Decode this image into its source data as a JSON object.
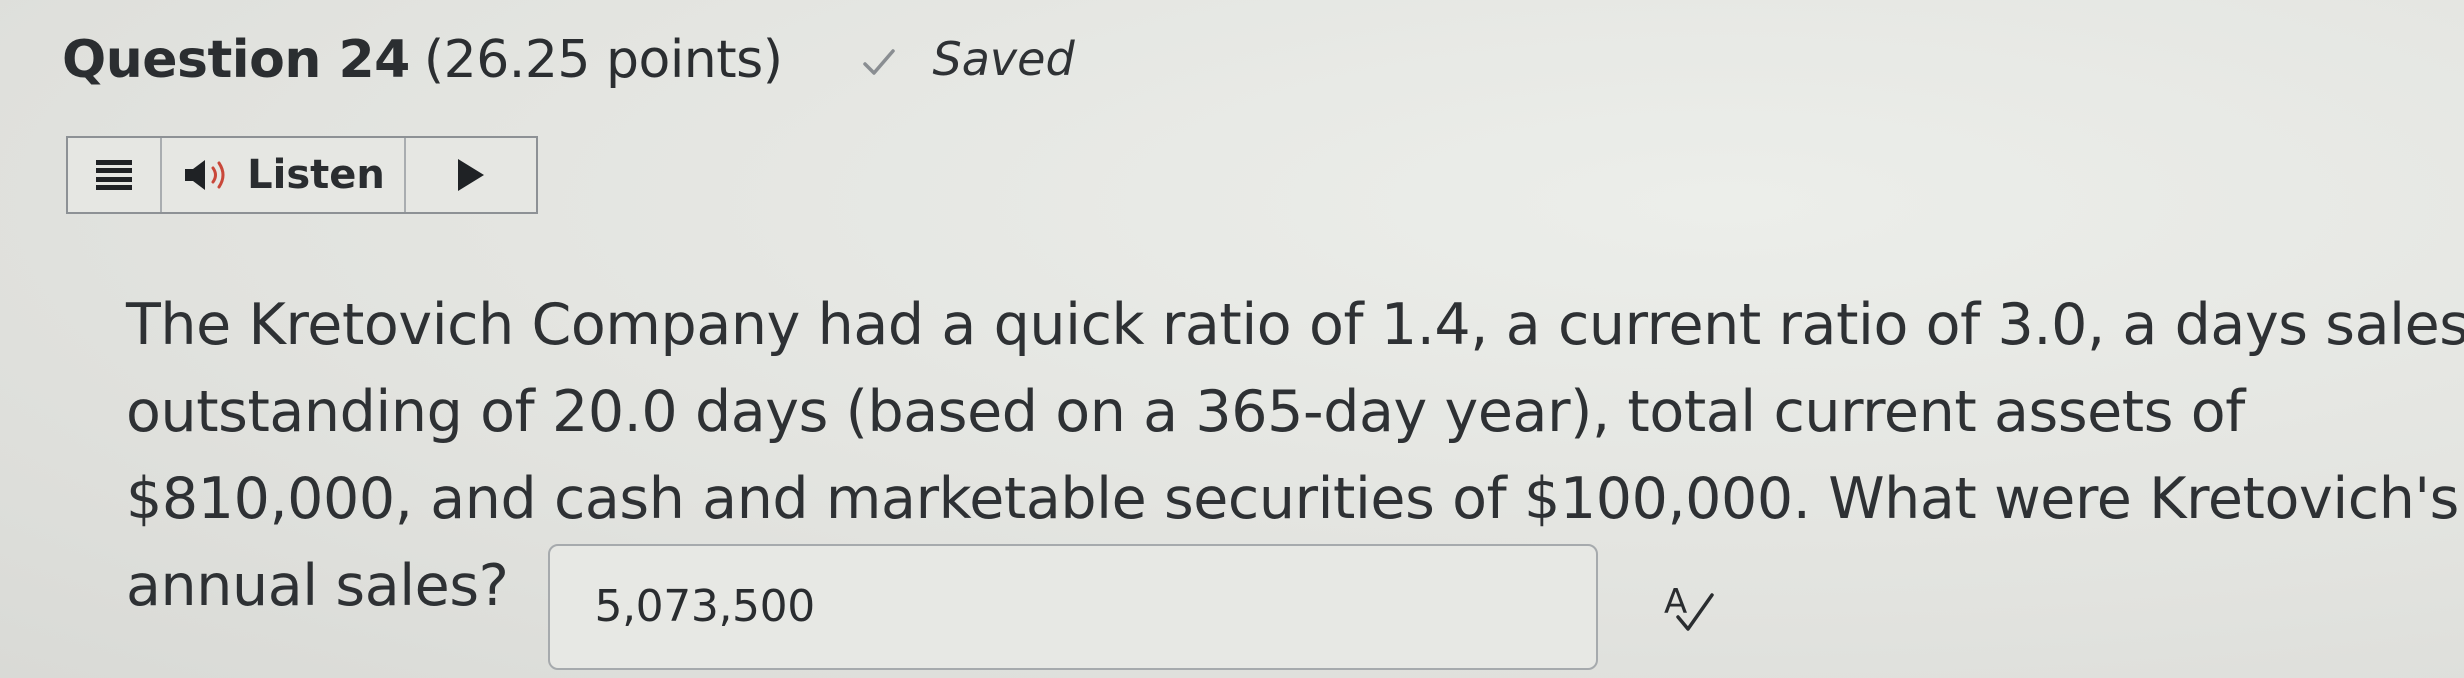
{
  "question": {
    "title": "Question 24",
    "points": "(26.25 points)",
    "status": "Saved",
    "status_icon": "check-icon"
  },
  "toolbar": {
    "menu_icon": "menu-icon",
    "speaker_icon": "speaker-icon",
    "listen_label": "Listen",
    "play_icon": "play-icon"
  },
  "body": {
    "line1": "The Kretovich Company had a quick ratio of 1.4, a current ratio of 3.0, a days sales",
    "line2": "outstanding of 20.0 days (based on a 365-day year), total current assets of",
    "line3": "$810,000, and cash and marketable securities of $100,000. What were Kretovich's",
    "line4": "annual sales?"
  },
  "answer": {
    "value": "5,073,500",
    "spellcheck_icon": "spellcheck-icon"
  }
}
